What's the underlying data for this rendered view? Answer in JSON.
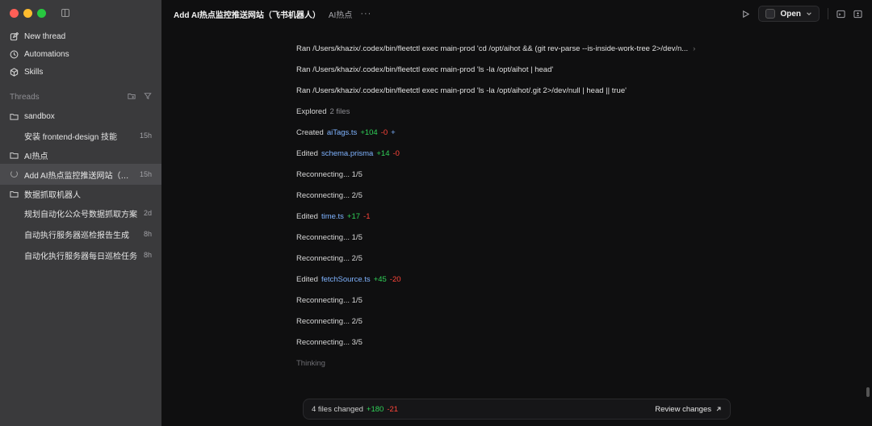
{
  "sidebar": {
    "nav": [
      {
        "label": "New thread",
        "icon": "edit-icon"
      },
      {
        "label": "Automations",
        "icon": "clock-icon"
      },
      {
        "label": "Skills",
        "icon": "cube-icon"
      }
    ],
    "threads_label": "Threads",
    "groups": [
      {
        "folder": "sandbox",
        "threads": [
          {
            "title": "安装 frontend-design 技能",
            "time": "15h"
          }
        ]
      },
      {
        "folder": "AI热点",
        "threads": [
          {
            "title": "Add AI热点监控推送网站（飞书机器人）",
            "time": "15h",
            "active": true
          }
        ]
      },
      {
        "folder": "数据抓取机器人",
        "threads": [
          {
            "title": "规划自动化公众号数据抓取方案",
            "time": "2d"
          },
          {
            "title": "自动执行服务器巡检报告生成",
            "time": "8h"
          },
          {
            "title": "自动化执行服务器每日巡检任务",
            "time": "8h"
          }
        ]
      }
    ]
  },
  "header": {
    "title": "Add AI热点监控推送网站（飞书机器人）",
    "project": "AI热点",
    "more": "···",
    "open_label": "Open"
  },
  "log": {
    "ran1": "Ran /Users/khazix/.codex/bin/fleetctl exec main-prod 'cd /opt/aihot && (git rev-parse --is-inside-work-tree 2>/dev/n...",
    "ran2": "Ran /Users/khazix/.codex/bin/fleetctl exec main-prod 'ls -la /opt/aihot | head'",
    "ran3": "Ran /Users/khazix/.codex/bin/fleetctl exec main-prod 'ls -la /opt/aihot/.git 2>/dev/null | head || true'",
    "explored": "Explored",
    "explored_count": "2 files",
    "created_label": "Created",
    "created_file": "aiTags.ts",
    "created_add": "+104",
    "created_del": "-0",
    "created_extra": "+",
    "edited_label": "Edited",
    "edit1_file": "schema.prisma",
    "edit1_add": "+14",
    "edit1_del": "-0",
    "reconnect_1_5": "Reconnecting... 1/5",
    "reconnect_2_5": "Reconnecting... 2/5",
    "reconnect_3_5": "Reconnecting... 3/5",
    "edit2_file": "time.ts",
    "edit2_add": "+17",
    "edit2_del": "-1",
    "edit3_file": "fetchSource.ts",
    "edit3_add": "+45",
    "edit3_del": "-20",
    "thinking": "Thinking"
  },
  "changes": {
    "summary": "4 files changed",
    "add": "+180",
    "del": "-21",
    "review_label": "Review changes"
  },
  "colors": {
    "sidebar_bg": "#3a3a3c",
    "main_bg": "#0f0f10",
    "add": "#30d158",
    "del": "#ff453a",
    "file_link": "#7fb3ff"
  }
}
